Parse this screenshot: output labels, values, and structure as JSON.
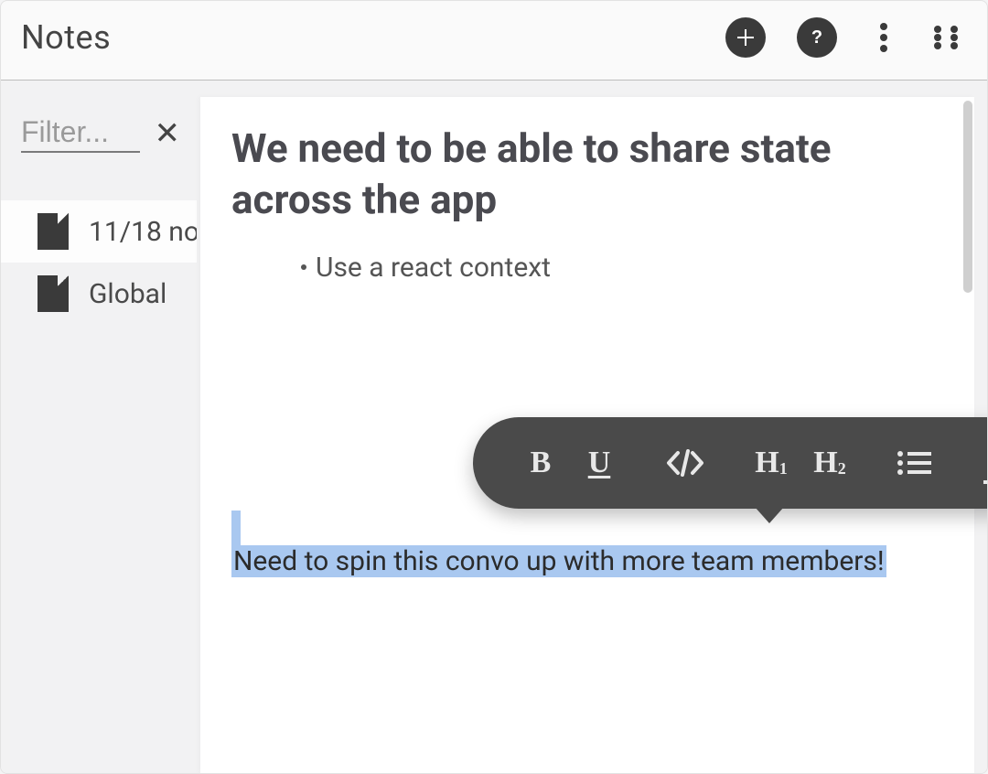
{
  "header": {
    "title": "Notes",
    "add_icon": "plus",
    "help_icon": "question",
    "overflow_icon": "more-vert",
    "apps_icon": "grid"
  },
  "sidebar": {
    "filter_placeholder": "Filter...",
    "notes": [
      {
        "label": "11/18 no",
        "selected": true
      },
      {
        "label": "Global ",
        "selected": false
      }
    ]
  },
  "editor": {
    "title": "We need to be able to share state across the app",
    "bullets": [
      "Use a react context"
    ],
    "highlighted_text": "Need to spin this convo up with more team members!"
  },
  "toolbar": {
    "bold": "B",
    "underline": "U",
    "code": "</>",
    "h1": "H",
    "h1_sub": "1",
    "h2": "H",
    "h2_sub": "2",
    "list": "list",
    "color": "A"
  }
}
